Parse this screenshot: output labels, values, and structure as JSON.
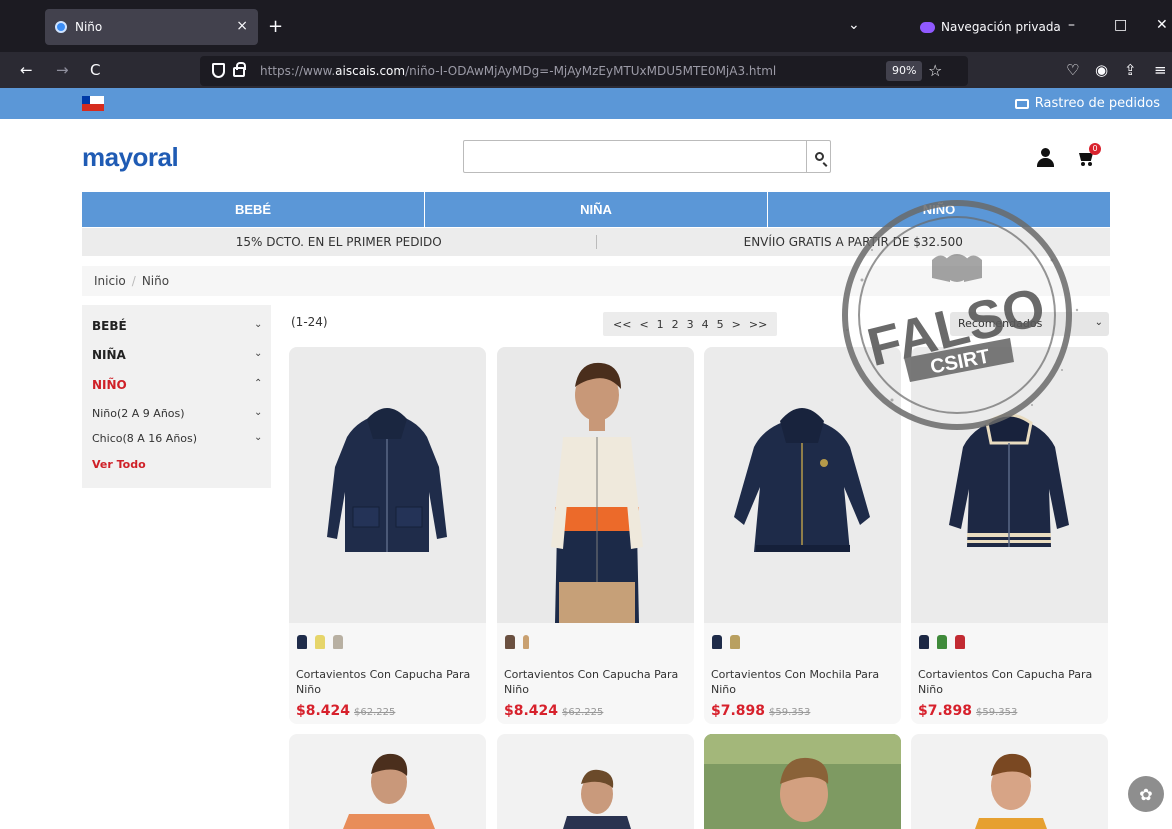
{
  "browser": {
    "tab_title": "Niño",
    "tab_close": "×",
    "new_tab": "+",
    "tabs_menu": "⌄",
    "private_label": "Navegación privada",
    "minimize": "–",
    "maximize": "□",
    "close": "✕",
    "back": "←",
    "forward": "→",
    "reload": "C",
    "url_base": "https://www.",
    "url_domain": "aiscais.com",
    "url_path": "/niño-I-ODAwMjAyMDg=-MjAyMzEyMTUxMDU5MTE0MjA3.html",
    "zoom": "90%",
    "bookmark": "☆",
    "pocket": "♡",
    "account": "◉",
    "extensions": "⇪",
    "menu": "≡"
  },
  "site": {
    "tracking": "Rastreo de pedidos",
    "logo": "mayoral",
    "search_placeholder": "",
    "cart_count": "0",
    "categories": [
      "BEBÉ",
      "NIÑA",
      "NIÑO"
    ],
    "promos": [
      "15% DCTO. EN EL PRIMER PEDIDO",
      "ENVÍIO GRATIS A PARTIR DE $32.500"
    ],
    "breadcrumb": {
      "home": "Inicio",
      "sep": "/",
      "current": "Niño"
    }
  },
  "sidebar": {
    "items": [
      {
        "label": "BEBÉ",
        "chev": "⌄"
      },
      {
        "label": "NIÑA",
        "chev": "⌄"
      },
      {
        "label": "NIÑO",
        "chev": "⌃"
      },
      {
        "label": "Niño(2 A 9 Años)",
        "chev": "⌄"
      },
      {
        "label": "Chico(8 A 16 Años)",
        "chev": "⌄"
      },
      {
        "label": "Ver Todo"
      }
    ]
  },
  "listing": {
    "count": "(1-24)",
    "pager": [
      "<<",
      "<",
      "1",
      "2",
      "3",
      "4",
      "5",
      ">",
      ">>"
    ],
    "sort": "Recomendados",
    "sort_chev": "⌄"
  },
  "products": [
    {
      "name": "Cortavientos Con Capucha Para Niño",
      "price": "$8.424",
      "old_price": "$62.225"
    },
    {
      "name": "Cortavientos Con Capucha Para Niño",
      "price": "$8.424",
      "old_price": "$62.225"
    },
    {
      "name": "Cortavientos Con Mochila Para Niño",
      "price": "$7.898",
      "old_price": "$59.353"
    },
    {
      "name": "Cortavientos Con Capucha Para Niño",
      "price": "$7.898",
      "old_price": "$59.353"
    }
  ],
  "stamp": {
    "text": "FALSO",
    "org": "CSIRT"
  },
  "colors": {
    "brand_blue": "#5b97d7",
    "logo_blue": "#1f5bb4",
    "price_red": "#d7212c",
    "stamp_gray": "#5a5a5a"
  }
}
